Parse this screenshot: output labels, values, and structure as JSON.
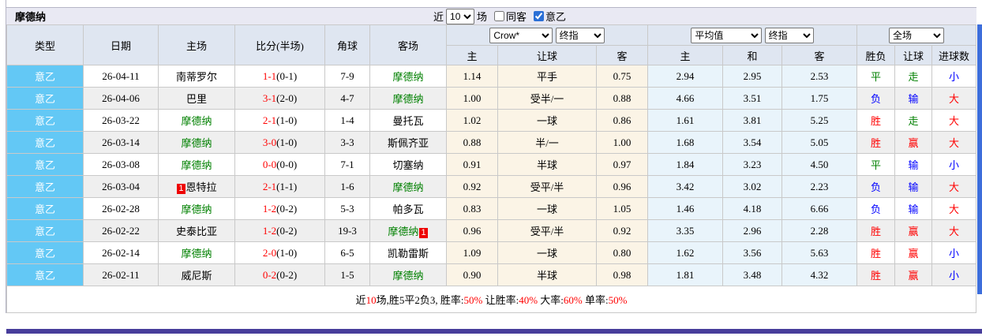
{
  "title": "摩德纳",
  "controls": {
    "near": "近",
    "count": "10",
    "unit": "场",
    "same_away": "同客",
    "league": "意乙"
  },
  "dropdowns": {
    "source": "Crow*",
    "time1": "终指",
    "avg": "平均值",
    "time2": "终指",
    "scope": "全场"
  },
  "columns": {
    "type": "类型",
    "date": "日期",
    "home": "主场",
    "score": "比分(半场)",
    "corner": "角球",
    "away": "客场",
    "sub": [
      "主",
      "让球",
      "客",
      "主",
      "和",
      "客",
      "胜负",
      "让球",
      "进球数"
    ]
  },
  "rows": [
    {
      "league": "意乙",
      "date": "26-04-11",
      "home": {
        "name": "南蒂罗尔",
        "green": false,
        "badge": null,
        "badge_side": null
      },
      "score": "1-1",
      "half": "(0-1)",
      "corner": "7-9",
      "away": {
        "name": "摩德纳",
        "green": true,
        "badge": null,
        "badge_side": null
      },
      "odds": [
        "1.14",
        "平手",
        "0.75"
      ],
      "avg": [
        "2.94",
        "2.95",
        "2.53"
      ],
      "results": [
        {
          "text": "平",
          "color": "green"
        },
        {
          "text": "走",
          "color": "green"
        },
        {
          "text": "小",
          "color": "blue"
        }
      ]
    },
    {
      "league": "意乙",
      "date": "26-04-06",
      "home": {
        "name": "巴里",
        "green": false,
        "badge": null,
        "badge_side": null
      },
      "score": "3-1",
      "half": "(2-0)",
      "corner": "4-7",
      "away": {
        "name": "摩德纳",
        "green": true,
        "badge": null,
        "badge_side": null
      },
      "odds": [
        "1.00",
        "受半/一",
        "0.88"
      ],
      "avg": [
        "4.66",
        "3.51",
        "1.75"
      ],
      "results": [
        {
          "text": "负",
          "color": "blue"
        },
        {
          "text": "输",
          "color": "blue"
        },
        {
          "text": "大",
          "color": "red"
        }
      ]
    },
    {
      "league": "意乙",
      "date": "26-03-22",
      "home": {
        "name": "摩德纳",
        "green": true,
        "badge": null,
        "badge_side": null
      },
      "score": "2-1",
      "half": "(1-0)",
      "corner": "1-4",
      "away": {
        "name": "曼托瓦",
        "green": false,
        "badge": null,
        "badge_side": null
      },
      "odds": [
        "1.02",
        "一球",
        "0.86"
      ],
      "avg": [
        "1.61",
        "3.81",
        "5.25"
      ],
      "results": [
        {
          "text": "胜",
          "color": "red"
        },
        {
          "text": "走",
          "color": "green"
        },
        {
          "text": "大",
          "color": "red"
        }
      ]
    },
    {
      "league": "意乙",
      "date": "26-03-14",
      "home": {
        "name": "摩德纳",
        "green": true,
        "badge": null,
        "badge_side": null
      },
      "score": "3-0",
      "half": "(1-0)",
      "corner": "3-3",
      "away": {
        "name": "斯佩齐亚",
        "green": false,
        "badge": null,
        "badge_side": null
      },
      "odds": [
        "0.88",
        "半/一",
        "1.00"
      ],
      "avg": [
        "1.68",
        "3.54",
        "5.05"
      ],
      "results": [
        {
          "text": "胜",
          "color": "red"
        },
        {
          "text": "赢",
          "color": "red"
        },
        {
          "text": "大",
          "color": "red"
        }
      ]
    },
    {
      "league": "意乙",
      "date": "26-03-08",
      "home": {
        "name": "摩德纳",
        "green": true,
        "badge": null,
        "badge_side": null
      },
      "score": "0-0",
      "half": "(0-0)",
      "corner": "7-1",
      "away": {
        "name": "切塞纳",
        "green": false,
        "badge": null,
        "badge_side": null
      },
      "odds": [
        "0.91",
        "半球",
        "0.97"
      ],
      "avg": [
        "1.84",
        "3.23",
        "4.50"
      ],
      "results": [
        {
          "text": "平",
          "color": "green"
        },
        {
          "text": "输",
          "color": "blue"
        },
        {
          "text": "小",
          "color": "blue"
        }
      ]
    },
    {
      "league": "意乙",
      "date": "26-03-04",
      "home": {
        "name": "恩特拉",
        "green": false,
        "badge": "1",
        "badge_side": "left"
      },
      "score": "2-1",
      "half": "(1-1)",
      "corner": "1-6",
      "away": {
        "name": "摩德纳",
        "green": true,
        "badge": null,
        "badge_side": null
      },
      "odds": [
        "0.92",
        "受平/半",
        "0.96"
      ],
      "avg": [
        "3.42",
        "3.02",
        "2.23"
      ],
      "results": [
        {
          "text": "负",
          "color": "blue"
        },
        {
          "text": "输",
          "color": "blue"
        },
        {
          "text": "大",
          "color": "red"
        }
      ]
    },
    {
      "league": "意乙",
      "date": "26-02-28",
      "home": {
        "name": "摩德纳",
        "green": true,
        "badge": null,
        "badge_side": null
      },
      "score": "1-2",
      "half": "(0-2)",
      "corner": "5-3",
      "away": {
        "name": "帕多瓦",
        "green": false,
        "badge": null,
        "badge_side": null
      },
      "odds": [
        "0.83",
        "一球",
        "1.05"
      ],
      "avg": [
        "1.46",
        "4.18",
        "6.66"
      ],
      "results": [
        {
          "text": "负",
          "color": "blue"
        },
        {
          "text": "输",
          "color": "blue"
        },
        {
          "text": "大",
          "color": "red"
        }
      ]
    },
    {
      "league": "意乙",
      "date": "26-02-22",
      "home": {
        "name": "史泰比亚",
        "green": false,
        "badge": null,
        "badge_side": null
      },
      "score": "1-2",
      "half": "(0-2)",
      "corner": "19-3",
      "away": {
        "name": "摩德纳",
        "green": true,
        "badge": "1",
        "badge_side": "right"
      },
      "odds": [
        "0.96",
        "受平/半",
        "0.92"
      ],
      "avg": [
        "3.35",
        "2.96",
        "2.28"
      ],
      "results": [
        {
          "text": "胜",
          "color": "red"
        },
        {
          "text": "赢",
          "color": "red"
        },
        {
          "text": "大",
          "color": "red"
        }
      ]
    },
    {
      "league": "意乙",
      "date": "26-02-14",
      "home": {
        "name": "摩德纳",
        "green": true,
        "badge": null,
        "badge_side": null
      },
      "score": "2-0",
      "half": "(1-0)",
      "corner": "6-5",
      "away": {
        "name": "凯勒雷斯",
        "green": false,
        "badge": null,
        "badge_side": null
      },
      "odds": [
        "1.09",
        "一球",
        "0.80"
      ],
      "avg": [
        "1.62",
        "3.56",
        "5.63"
      ],
      "results": [
        {
          "text": "胜",
          "color": "red"
        },
        {
          "text": "赢",
          "color": "red"
        },
        {
          "text": "小",
          "color": "blue"
        }
      ]
    },
    {
      "league": "意乙",
      "date": "26-02-11",
      "home": {
        "name": "威尼斯",
        "green": false,
        "badge": null,
        "badge_side": null
      },
      "score": "0-2",
      "half": "(0-2)",
      "corner": "1-5",
      "away": {
        "name": "摩德纳",
        "green": true,
        "badge": null,
        "badge_side": null
      },
      "odds": [
        "0.90",
        "半球",
        "0.98"
      ],
      "avg": [
        "1.81",
        "3.48",
        "4.32"
      ],
      "results": [
        {
          "text": "胜",
          "color": "red"
        },
        {
          "text": "赢",
          "color": "red"
        },
        {
          "text": "小",
          "color": "blue"
        }
      ]
    }
  ],
  "footer": {
    "segments": [
      {
        "text": "近",
        "color": "black"
      },
      {
        "text": "10",
        "color": "red"
      },
      {
        "text": "场,胜5平2负3, 胜率:",
        "color": "black"
      },
      {
        "text": "50%",
        "color": "red"
      },
      {
        "text": " 让胜率:",
        "color": "black"
      },
      {
        "text": "40%",
        "color": "red"
      },
      {
        "text": " 大率:",
        "color": "black"
      },
      {
        "text": "60%",
        "color": "red"
      },
      {
        "text": " 单率:",
        "color": "black"
      },
      {
        "text": "50%",
        "color": "red"
      }
    ]
  },
  "colors": {
    "type_blue": "#63c8f5",
    "red": "#ff0000",
    "green": "#008000",
    "blue": "#0000ff",
    "bar_purple": "#473d9b",
    "strip_blue": "#3d6edb"
  }
}
